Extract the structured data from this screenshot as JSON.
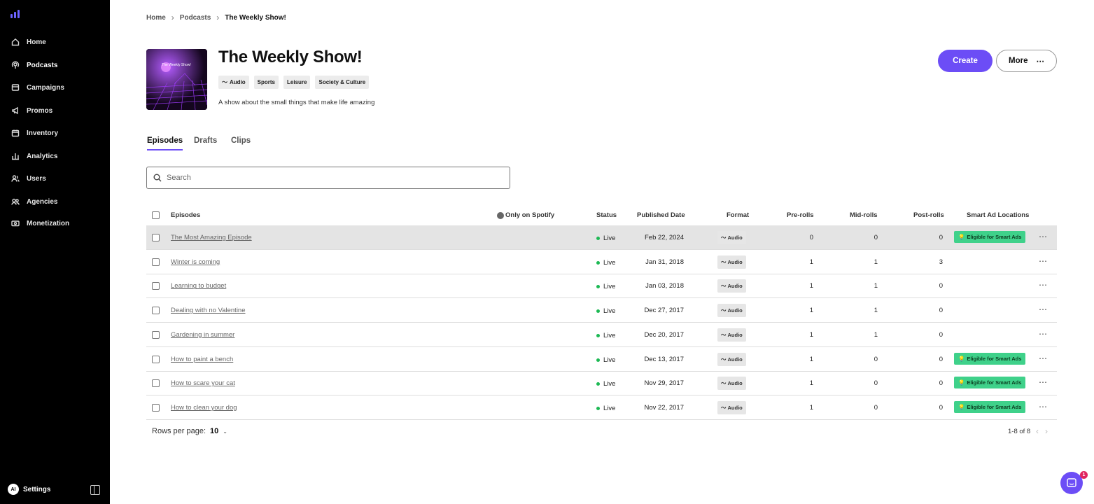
{
  "sidebar": {
    "items": [
      {
        "label": "Home",
        "icon": "home-icon"
      },
      {
        "label": "Podcasts",
        "icon": "podcast-icon"
      },
      {
        "label": "Campaigns",
        "icon": "campaign-icon"
      },
      {
        "label": "Promos",
        "icon": "megaphone-icon"
      },
      {
        "label": "Inventory",
        "icon": "calendar-icon"
      },
      {
        "label": "Analytics",
        "icon": "bar-chart-icon"
      },
      {
        "label": "Users",
        "icon": "users-icon"
      },
      {
        "label": "Agencies",
        "icon": "agency-icon"
      },
      {
        "label": "Monetization",
        "icon": "money-icon"
      }
    ],
    "active": "Podcasts",
    "avatar_initials": "AI",
    "settings_label": "Settings"
  },
  "breadcrumb": {
    "home": "Home",
    "podcasts": "Podcasts",
    "current": "The Weekly Show!"
  },
  "show": {
    "title": "The Weekly Show!",
    "cover_text": "The Weekly Show!",
    "tags": [
      "Audio",
      "Sports",
      "Leisure",
      "Society & Culture"
    ],
    "description": "A show about the small things that make life amazing"
  },
  "actions": {
    "create": "Create",
    "more": "More"
  },
  "tabs": [
    "Episodes",
    "Drafts",
    "Clips"
  ],
  "search": {
    "placeholder": "Search"
  },
  "table": {
    "headers": {
      "episodes": "Episodes",
      "spotify": "Only on Spotify",
      "status": "Status",
      "published": "Published Date",
      "format": "Format",
      "pre": "Pre-rolls",
      "mid": "Mid-rolls",
      "post": "Post-rolls",
      "smart": "Smart Ad Locations"
    },
    "rows": [
      {
        "title": "The Most Amazing Episode",
        "status": "Live",
        "date": "Feb 22, 2024",
        "format": "Audio",
        "pre": "0",
        "mid": "0",
        "post": "0",
        "smart": "Eligible for Smart Ads"
      },
      {
        "title": "Winter is coming",
        "status": "Live",
        "date": "Jan 31, 2018",
        "format": "Audio",
        "pre": "1",
        "mid": "1",
        "post": "3",
        "smart": ""
      },
      {
        "title": "Learning to budget",
        "status": "Live",
        "date": "Jan 03, 2018",
        "format": "Audio",
        "pre": "1",
        "mid": "1",
        "post": "0",
        "smart": ""
      },
      {
        "title": "Dealing with no Valentine",
        "status": "Live",
        "date": "Dec 27, 2017",
        "format": "Audio",
        "pre": "1",
        "mid": "1",
        "post": "0",
        "smart": ""
      },
      {
        "title": "Gardening in summer",
        "status": "Live",
        "date": "Dec 20, 2017",
        "format": "Audio",
        "pre": "1",
        "mid": "1",
        "post": "0",
        "smart": ""
      },
      {
        "title": "How to paint a bench",
        "status": "Live",
        "date": "Dec 13, 2017",
        "format": "Audio",
        "pre": "1",
        "mid": "0",
        "post": "0",
        "smart": "Eligible for Smart Ads"
      },
      {
        "title": "How to scare your cat",
        "status": "Live",
        "date": "Nov 29, 2017",
        "format": "Audio",
        "pre": "1",
        "mid": "0",
        "post": "0",
        "smart": "Eligible for Smart Ads"
      },
      {
        "title": "How to clean your dog",
        "status": "Live",
        "date": "Nov 22, 2017",
        "format": "Audio",
        "pre": "1",
        "mid": "0",
        "post": "0",
        "smart": "Eligible for Smart Ads"
      }
    ]
  },
  "pagination": {
    "rows_label": "Rows per page:",
    "rows_value": "10",
    "range": "1-8 of 8"
  },
  "chat": {
    "badge": "1"
  },
  "colors": {
    "accent": "#6c4df6",
    "live": "#1db954",
    "smart": "#3fd18a",
    "sidebar_bg": "#000000"
  }
}
